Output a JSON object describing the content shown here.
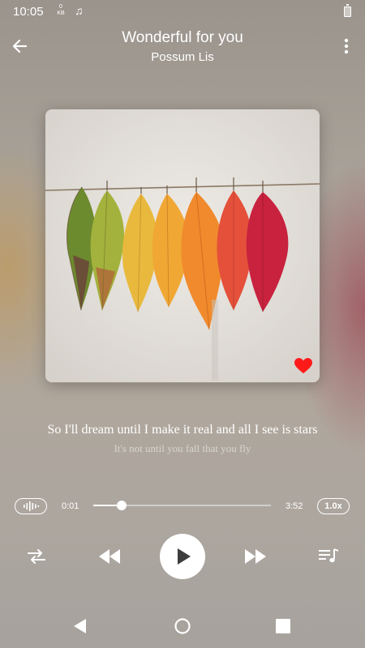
{
  "status_bar": {
    "time": "10:05",
    "net_speed_value": "0",
    "net_speed_unit": "KB",
    "music_icon": "music-note-icon",
    "battery_icon": "battery-icon"
  },
  "header": {
    "title": "Wonderful for you",
    "artist": "Possum Lis",
    "back_icon": "arrow-left-icon",
    "menu_icon": "more-vertical-icon"
  },
  "album": {
    "favorited": true,
    "heart_color": "#ff1a1a"
  },
  "lyrics": {
    "current": "So I'll dream until I make it real and all I see is stars",
    "next": "It's not until you fall that you fly"
  },
  "playback": {
    "elapsed": "0:01",
    "duration": "3:52",
    "progress": 0.16,
    "speed": "1.0x",
    "playing": false
  },
  "controls": {
    "repeat_icon": "repeat-icon",
    "rewind_icon": "rewind-icon",
    "play_icon": "play-icon",
    "fast_forward_icon": "fast-forward-icon",
    "queue_icon": "playlist-icon",
    "equalizer_icon": "equalizer-icon"
  },
  "colors": {
    "foreground": "#ffffff",
    "play_glyph": "#3d3d3d"
  }
}
